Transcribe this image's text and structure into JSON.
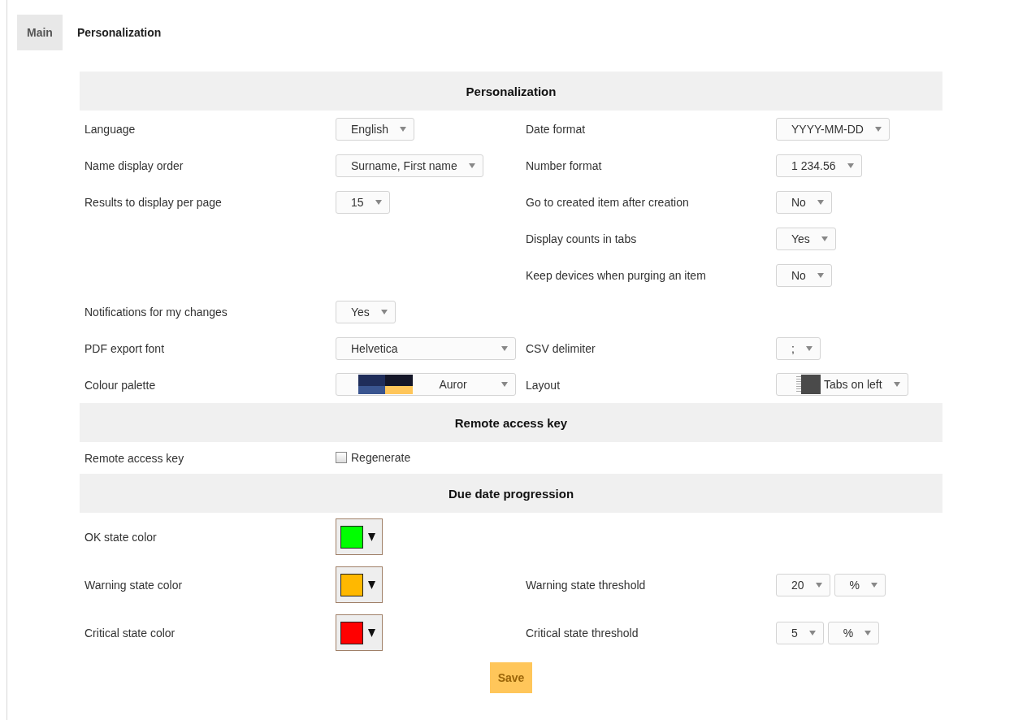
{
  "tabs": [
    {
      "label": "Main",
      "selected": false
    },
    {
      "label": "Personalization",
      "selected": true
    }
  ],
  "sections": [
    {
      "title": "Personalization",
      "rows": [
        {
          "left": {
            "label": "Language",
            "control": {
              "kind": "select",
              "value": "English"
            }
          },
          "right": {
            "label": "Date format",
            "control": {
              "kind": "select",
              "value": "YYYY-MM-DD"
            }
          }
        },
        {
          "left": {
            "label": "Name display order",
            "control": {
              "kind": "select",
              "value": "Surname, First name"
            }
          },
          "right": {
            "label": "Number format",
            "control": {
              "kind": "select",
              "value": "1 234.56"
            }
          }
        },
        {
          "left": {
            "label": "Results to display per page",
            "control": {
              "kind": "select",
              "value": "15"
            }
          },
          "right": {
            "label": "Go to created item after creation",
            "control": {
              "kind": "select",
              "value": "No"
            }
          }
        },
        {
          "right": {
            "label": "Display counts in tabs",
            "control": {
              "kind": "select",
              "value": "Yes"
            }
          }
        },
        {
          "right": {
            "label": "Keep devices when purging an item",
            "control": {
              "kind": "select",
              "value": "No"
            }
          }
        },
        {
          "left": {
            "label": "Notifications for my changes",
            "control": {
              "kind": "select",
              "value": "Yes"
            }
          }
        },
        {
          "left": {
            "label": "PDF export font",
            "control": {
              "kind": "wide_select",
              "value": "Helvetica"
            }
          },
          "right": {
            "label": "CSV delimiter",
            "control": {
              "kind": "select",
              "value": ";"
            }
          }
        },
        {
          "left": {
            "label": "Colour palette",
            "control": {
              "kind": "palette",
              "value": "Auror"
            }
          },
          "right": {
            "label": "Layout",
            "control": {
              "kind": "layout",
              "value": "Tabs on left"
            }
          }
        }
      ]
    },
    {
      "title": "Remote access key",
      "rows": [
        {
          "left": {
            "label": "Remote access key",
            "control": {
              "kind": "checkbox",
              "label": "Regenerate",
              "checked": false
            }
          }
        }
      ]
    },
    {
      "title": "Due date progression",
      "rows": [
        {
          "left": {
            "label": "OK state color",
            "control": {
              "kind": "color",
              "color": "#00ff00"
            }
          }
        },
        {
          "left": {
            "label": "Warning state color",
            "control": {
              "kind": "color",
              "color": "#ffb800"
            }
          },
          "right": {
            "label": "Warning state threshold",
            "control": {
              "kind": "pair",
              "values": [
                "20",
                "%"
              ]
            }
          }
        },
        {
          "left": {
            "label": "Critical state color",
            "control": {
              "kind": "color",
              "color": "#ff0000"
            }
          },
          "right": {
            "label": "Critical state threshold",
            "control": {
              "kind": "pair",
              "values": [
                "5",
                "%"
              ]
            }
          }
        }
      ]
    }
  ],
  "save_button": "Save"
}
